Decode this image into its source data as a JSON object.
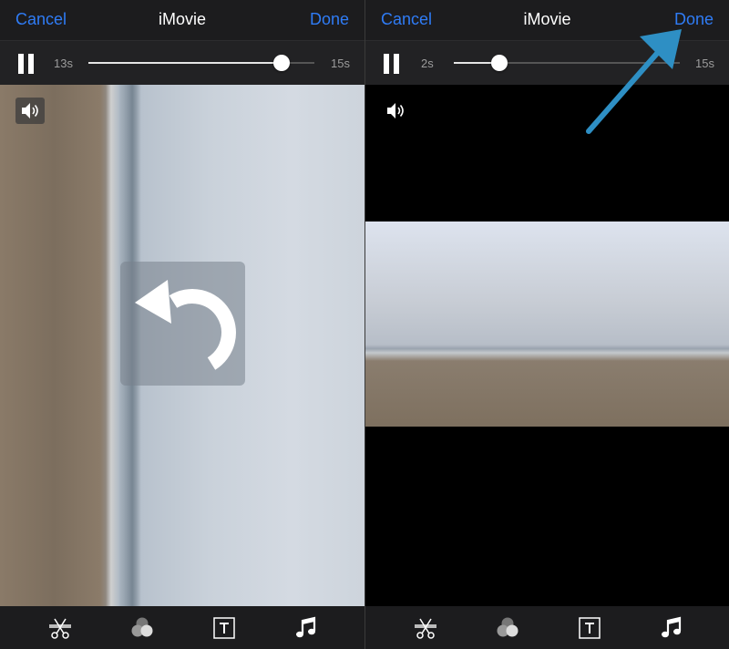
{
  "left": {
    "nav": {
      "cancel": "Cancel",
      "title": "iMovie",
      "done": "Done"
    },
    "player": {
      "current_time": "13s",
      "total_time": "15s",
      "progress": 0.855
    }
  },
  "right": {
    "nav": {
      "cancel": "Cancel",
      "title": "iMovie",
      "done": "Done"
    },
    "player": {
      "current_time": "2s",
      "total_time": "15s",
      "progress": 0.2
    }
  },
  "toolbar": {
    "icons": [
      "scissors-split-icon",
      "filters-icon",
      "text-title-icon",
      "music-note-icon"
    ]
  },
  "colors": {
    "accent": "#2f7cf6",
    "annotation_arrow": "#2e8fc4",
    "background": "#000000"
  }
}
